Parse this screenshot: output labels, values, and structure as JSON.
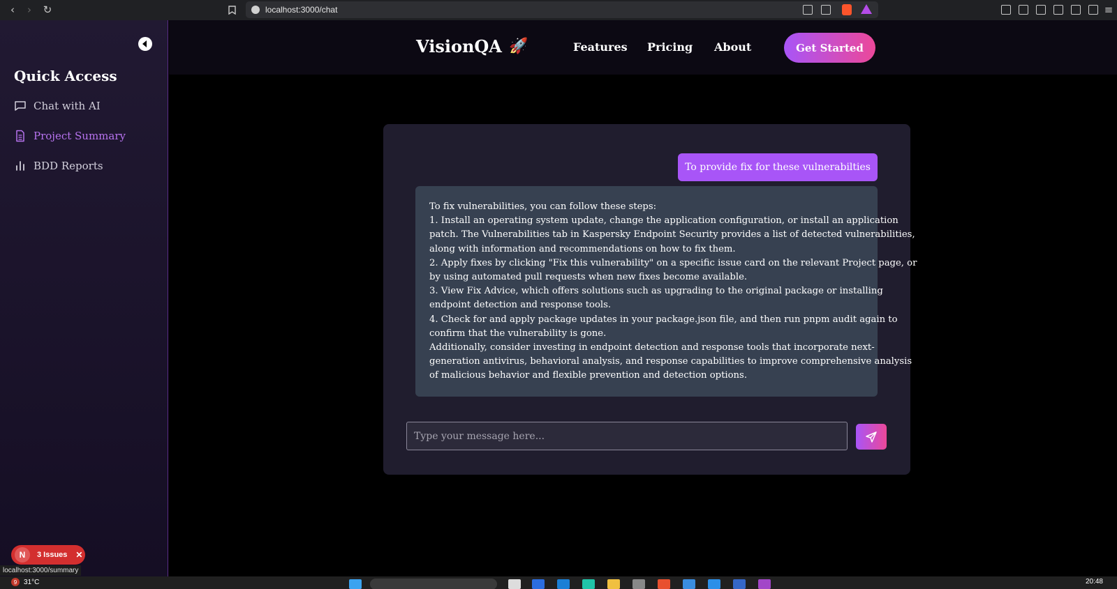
{
  "browser": {
    "url": "localhost:3000/chat"
  },
  "sidebar": {
    "title": "Quick Access",
    "items": [
      {
        "label": "Chat with AI",
        "icon": "chat-bubble-icon"
      },
      {
        "label": "Project Summary",
        "icon": "document-icon",
        "active": true
      },
      {
        "label": "BDD Reports",
        "icon": "bar-chart-icon"
      }
    ]
  },
  "header": {
    "brand": "VisionQA",
    "brand_emoji": "🚀",
    "nav": [
      "Features",
      "Pricing",
      "About"
    ],
    "cta": "Get Started"
  },
  "chat": {
    "user_message": "To provide fix for these vulnerabilties",
    "ai_lines": [
      "To fix vulnerabilities, you can follow these steps:",
      "1. Install an operating system update, change the application configuration, or install an application",
      "patch. The Vulnerabilities tab in Kaspersky Endpoint Security provides a list of detected vulnerabilities,",
      "along with information and recommendations on how to fix them.",
      "2. Apply fixes by clicking \"Fix this vulnerability\" on a specific issue card on the relevant Project page, or",
      "by using automated pull requests when new fixes become available.",
      "3. View Fix Advice, which offers solutions such as upgrading to the original package or installing",
      "endpoint detection and response tools.",
      "4. Check for and apply package updates in your package.json file, and then run pnpm audit again to",
      "confirm that the vulnerability is gone.",
      "Additionally, consider investing in endpoint detection and response tools that incorporate next-",
      "generation antivirus, behavioral analysis, and response capabilities to improve comprehensive analysis",
      "of malicious behavior and flexible prevention and detection options."
    ],
    "input_placeholder": "Type your message here..."
  },
  "issues_badge": {
    "letter": "N",
    "label": "3 Issues",
    "close": "✕"
  },
  "status_url": "localhost:3000/summary",
  "taskbar": {
    "weather_badge": "9",
    "temperature": "31°C",
    "time": "20:48"
  },
  "colors": {
    "accent_purple": "#a855f7",
    "accent_pink": "#ec4899",
    "sidebar_active": "#b773ef"
  }
}
